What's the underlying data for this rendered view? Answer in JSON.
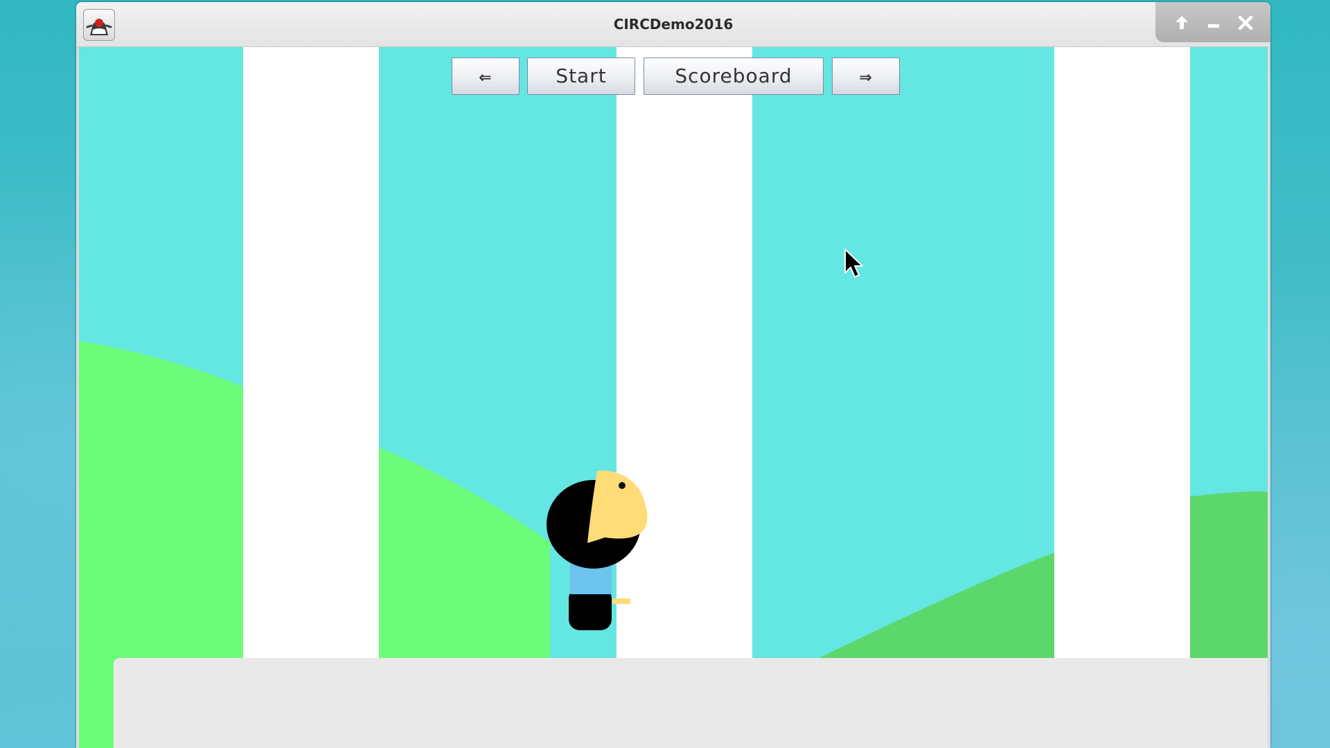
{
  "window": {
    "title": "CIRCDemo2016",
    "controls": [
      "maximize-icon",
      "minimize-icon",
      "close-icon"
    ]
  },
  "toolbar": {
    "prev_label": "⇐",
    "start_label": "Start",
    "scoreboard_label": "Scoreboard",
    "next_label": "⇒"
  },
  "icons": {
    "app": "java-duke-icon",
    "prev": "left-double-arrow-icon",
    "next": "right-double-arrow-icon",
    "cursor": "mouse-pointer-icon"
  },
  "colors": {
    "sky": "#64e6e2",
    "pillar": "#ffffff",
    "hill_light": "#6dfc7a",
    "hill_dark": "#5cd76c",
    "ground": "#e9e9e9",
    "character_hair": "#000000",
    "character_skin": "#ffdc78",
    "character_shirt": "#6cc4ee",
    "desktop": "#3fbcc7"
  }
}
